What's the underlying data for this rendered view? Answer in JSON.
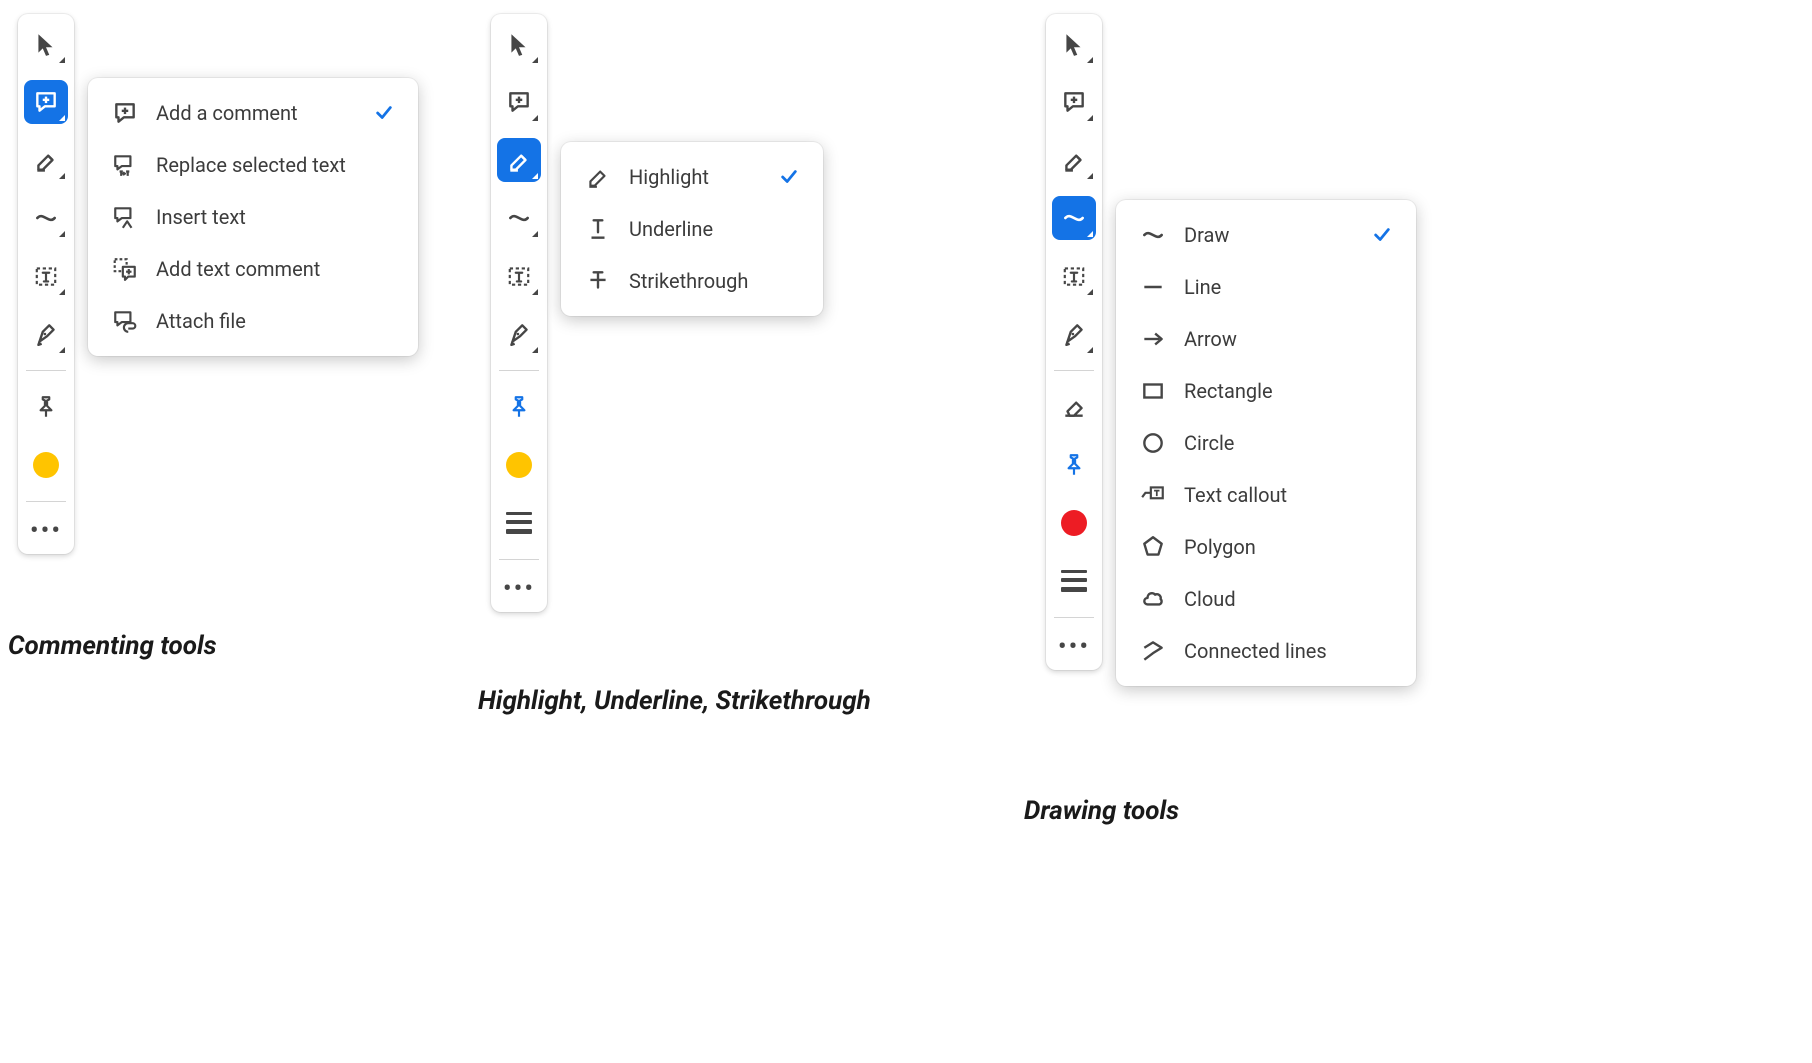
{
  "colors": {
    "accent": "#1473e6",
    "yellow": "#ffc400",
    "red": "#ed1c24"
  },
  "captions": {
    "commenting": "Commenting tools",
    "highlight": "Highlight, Underline, Strikethrough",
    "drawing": "Drawing tools"
  },
  "panel1": {
    "selected_tool": "add-comment-tool",
    "color": "#ffc400",
    "flyout": {
      "items": [
        {
          "id": "add-comment",
          "label": "Add a comment",
          "checked": true
        },
        {
          "id": "replace-text",
          "label": "Replace selected text",
          "checked": false
        },
        {
          "id": "insert-text",
          "label": "Insert text",
          "checked": false
        },
        {
          "id": "add-text-comment",
          "label": "Add text comment",
          "checked": false
        },
        {
          "id": "attach-file",
          "label": "Attach file",
          "checked": false
        }
      ]
    }
  },
  "panel2": {
    "selected_tool": "highlight-tool",
    "color": "#ffc400",
    "flyout": {
      "items": [
        {
          "id": "highlight",
          "label": "Highlight",
          "checked": true
        },
        {
          "id": "underline",
          "label": "Underline",
          "checked": false
        },
        {
          "id": "strikethrough",
          "label": "Strikethrough",
          "checked": false
        }
      ]
    }
  },
  "panel3": {
    "selected_tool": "draw-freeform-tool",
    "color": "#ed1c24",
    "flyout": {
      "items": [
        {
          "id": "draw",
          "label": "Draw",
          "checked": true
        },
        {
          "id": "line",
          "label": "Line",
          "checked": false
        },
        {
          "id": "arrow",
          "label": "Arrow",
          "checked": false
        },
        {
          "id": "rectangle",
          "label": "Rectangle",
          "checked": false
        },
        {
          "id": "circle",
          "label": "Circle",
          "checked": false
        },
        {
          "id": "text-callout",
          "label": "Text callout",
          "checked": false
        },
        {
          "id": "polygon",
          "label": "Polygon",
          "checked": false
        },
        {
          "id": "cloud",
          "label": "Cloud",
          "checked": false
        },
        {
          "id": "connected-lines",
          "label": "Connected lines",
          "checked": false
        }
      ]
    }
  }
}
